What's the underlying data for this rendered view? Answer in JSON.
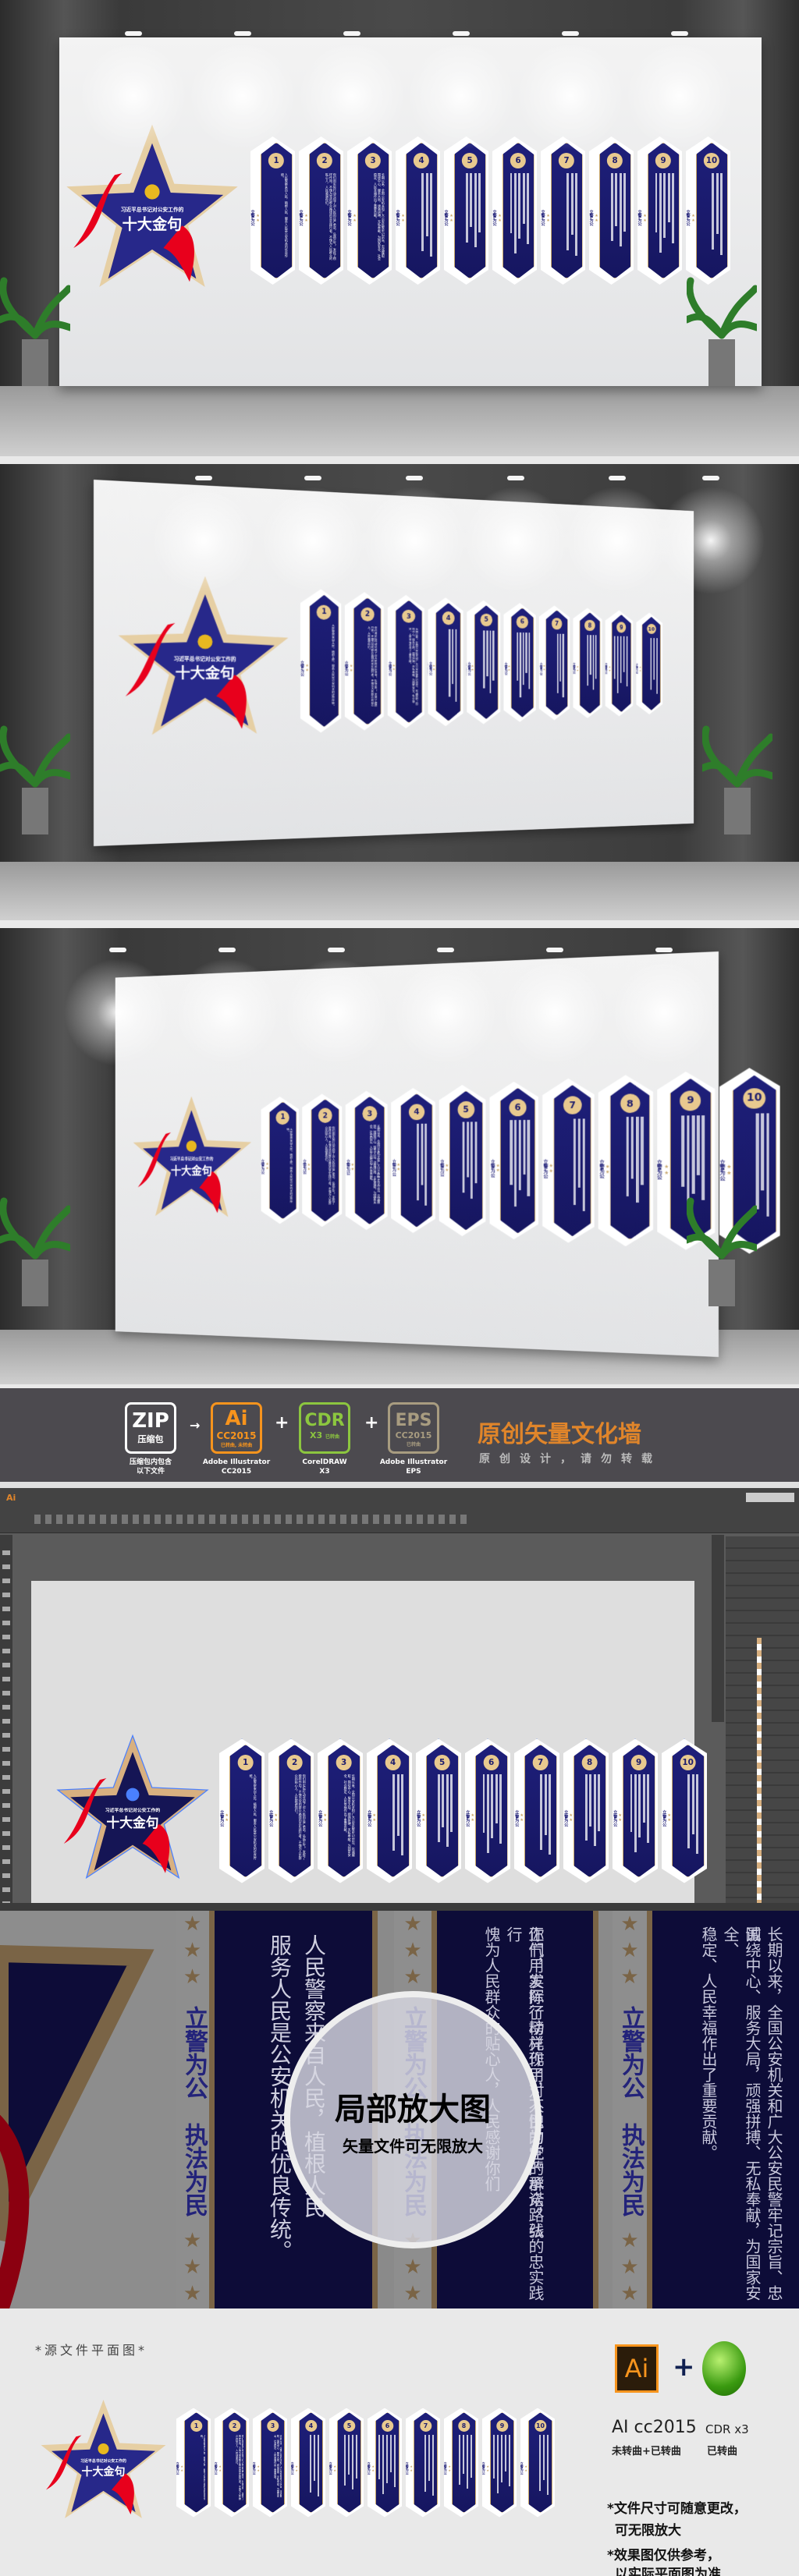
{
  "wall": {
    "star_subtitle": "习近平总书记对公安工作的",
    "star_title": "十大金句",
    "panel_numbers": [
      "1",
      "2",
      "3",
      "4",
      "5",
      "6",
      "7",
      "8",
      "9",
      "10"
    ],
    "motto_top": "立警为公",
    "motto_bottom": "执法为民",
    "panel_texts": [
      "人民警察来自人民，植根人民、服务人民是公安机关的优良传统。",
      "你们用实际行动兑现了对人民的庄严承诺，弘扬正气，发挥了榜样作用，不愧为党的群众路线的忠实践行者，不愧为人民群众的贴心人，人民感谢你们。",
      "长期以来，全国公安机关和广大公安民警牢记宗旨、忠诚履职，围绕中心、服务大局，顽强拼搏、无私奉献，为国家安全、社会稳定、人民幸福作出了重要贡献。"
    ]
  },
  "banner": {
    "zip": {
      "label": "ZIP",
      "sub": "压缩包",
      "caption": "压缩包内包含\n以下文件",
      "color": "#ffffff"
    },
    "ai": {
      "label": "Ai",
      "sub": "CC2015",
      "note": "已转曲, 未转曲",
      "caption": "Adobe Illustrator\nCC2015",
      "color": "#f7941d"
    },
    "cdr": {
      "label": "CDR",
      "sub": "X3",
      "note": "已转曲",
      "caption": "CorelDRAW\nX3",
      "color": "#8cc63f"
    },
    "eps": {
      "label": "EPS",
      "sub": "CC2015",
      "note": "已转曲",
      "caption": "Adobe Illustrator\nEPS",
      "color": "#a89c80"
    },
    "title": "原创矢量文化墙",
    "subtitle": "原创设计，请勿转载",
    "title_color": "#e0852a"
  },
  "editor": {
    "app_icon": "Ai"
  },
  "detail": {
    "title": "局部放大图",
    "subtitle": "矢量文件可无限放大",
    "motto_top": "立警为公",
    "motto_bottom": "执法为民",
    "col1": [
      "人民警察来自人民，植根人民",
      "服务人民是公安机关的优良传统。"
    ],
    "col2": [
      "你们用实际行动兑现了对人民的庄严承诺，弘",
      "正气，发挥了榜样作用，不愧为党的群众路线的忠实践行",
      "愧为人民群众的贴心人，人民感谢你们"
    ],
    "col3": [
      "长期以来，全国公安机关和广大公安民警牢记宗旨、忠诚",
      "围绕中心、服务大局，顽强拼搏、无私奉献，为国家安全、",
      "稳定、人民幸福作出了重要贡献。"
    ]
  },
  "bottom": {
    "heading": "*源文件平面图*",
    "ai_icon": "Ai",
    "ai_label": "AI cc2015",
    "ai_note": "未转曲+已转曲",
    "cdr_label": "CDR x3",
    "cdr_note": "已转曲",
    "note1a": "*文件尺寸可随意更改，",
    "note1b": "可无限放大",
    "note2a": "*效果图仅供参考，",
    "note2b": "以实际平面图为准"
  },
  "colors": {
    "navy": "#1a1a66",
    "gold": "#d8bc8c",
    "red": "#e8001c"
  }
}
